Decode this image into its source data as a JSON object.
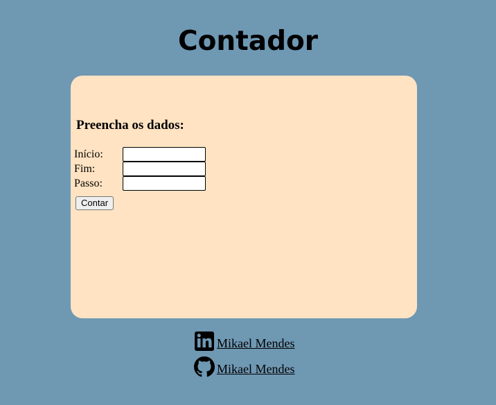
{
  "page": {
    "title": "Contador",
    "background": "#6f98b3",
    "card_color": "#ffe3c2"
  },
  "form": {
    "heading": "Preencha os dados:",
    "fields": [
      {
        "label": "Início:",
        "value": "",
        "placeholder": ""
      },
      {
        "label": "Fim:",
        "value": "",
        "placeholder": ""
      },
      {
        "label": "Passo:",
        "value": "",
        "placeholder": ""
      }
    ],
    "submit_label": "Contar"
  },
  "footer": {
    "links": [
      {
        "icon": "linkedin-icon",
        "text": "Mikael Mendes"
      },
      {
        "icon": "github-icon",
        "text": "Mikael Mendes"
      }
    ]
  }
}
